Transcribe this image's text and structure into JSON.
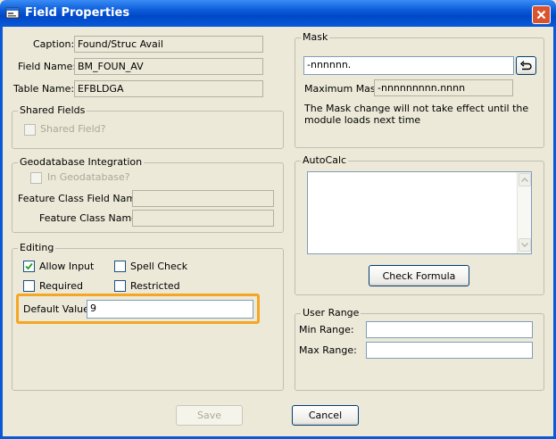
{
  "window": {
    "title": "Field Properties"
  },
  "fields": {
    "caption_label": "Caption:",
    "caption_value": "Found/Struc Avail",
    "field_name_label": "Field Name:",
    "field_name_value": "BM_FOUN_AV",
    "table_name_label": "Table Name:",
    "table_name_value": "EFBLDGA"
  },
  "shared": {
    "legend": "Shared Fields",
    "checkbox_label": "Shared Field?",
    "checked": false
  },
  "geodatabase": {
    "legend": "Geodatabase Integration",
    "checkbox_label": "In Geodatabase?",
    "fc_field_label": "Feature Class Field Name:",
    "fc_field_value": "",
    "fc_name_label": "Feature Class Name:",
    "fc_name_value": ""
  },
  "editing": {
    "legend": "Editing",
    "allow_input_label": "Allow Input",
    "allow_input_checked": true,
    "spell_check_label": "Spell Check",
    "spell_check_checked": false,
    "required_label": "Required",
    "required_checked": false,
    "restricted_label": "Restricted",
    "restricted_checked": false,
    "default_value_label": "Default Value:",
    "default_value": "9"
  },
  "mask": {
    "legend": "Mask",
    "value": "-nnnnnn.",
    "max_label": "Maximum Mask:",
    "max_value": "-nnnnnnnnn.nnnn",
    "note": "The Mask change will not take effect until the module loads next time"
  },
  "autocalc": {
    "legend": "AutoCalc",
    "formula": "",
    "check_button": "Check Formula"
  },
  "range": {
    "legend": "User Range",
    "min_label": "Min Range:",
    "min_value": "",
    "max_label": "Max Range:",
    "max_value": ""
  },
  "buttons": {
    "save": "Save",
    "cancel": "Cancel"
  },
  "colors": {
    "highlight": "#f5a623",
    "titlebar": "#0a5ad8"
  }
}
